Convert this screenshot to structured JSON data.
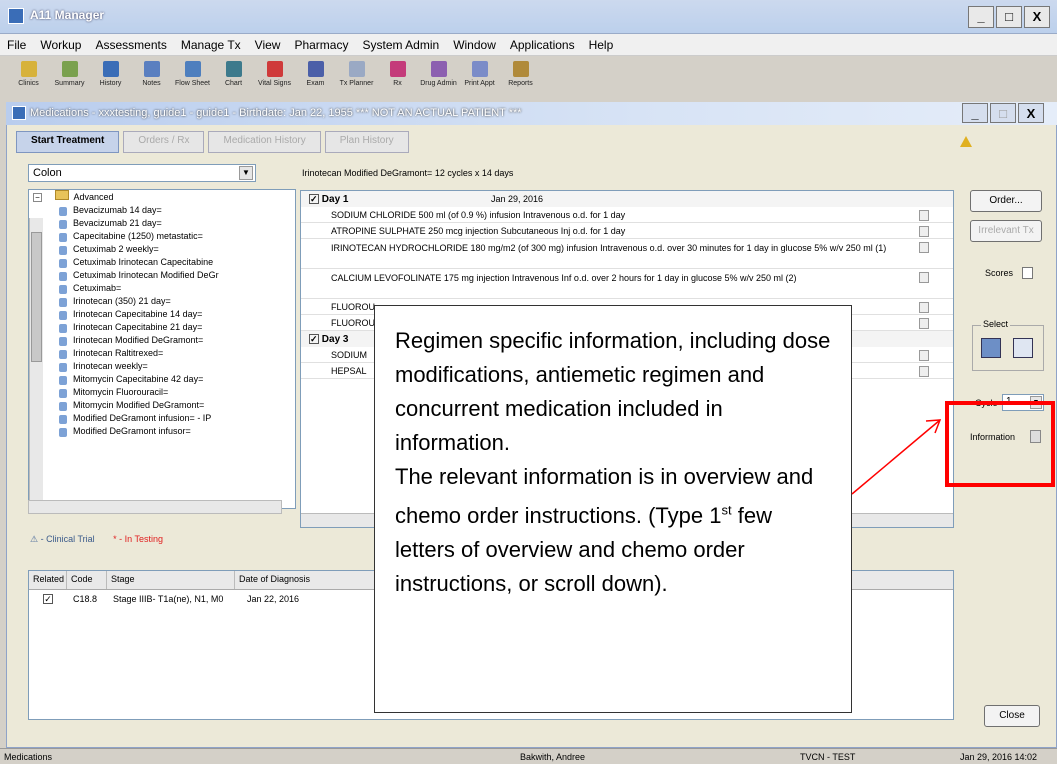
{
  "app": {
    "title": "A11 Manager"
  },
  "window_controls": {
    "minimize": "_",
    "maximize": "□",
    "close": "X"
  },
  "menu": [
    "File",
    "Workup",
    "Assessments",
    "Manage Tx",
    "View",
    "Pharmacy",
    "System Admin",
    "Window",
    "Applications",
    "Help"
  ],
  "toolbar": [
    {
      "label": "Clinics",
      "icon": "folder-icon",
      "color": "#d7b23b"
    },
    {
      "label": "Summary",
      "icon": "summary-icon",
      "color": "#7aa14e"
    },
    {
      "label": "History",
      "icon": "history-icon",
      "color": "#3a6db7"
    },
    {
      "label": "Notes",
      "icon": "notes-icon",
      "color": "#5a7fc0"
    },
    {
      "label": "Flow Sheet",
      "icon": "flowsheet-icon",
      "color": "#4e7fbe"
    },
    {
      "label": "Chart",
      "icon": "chart-icon",
      "color": "#3d7a8c"
    },
    {
      "label": "Vital Signs",
      "icon": "vitals-icon",
      "color": "#cf3a3a"
    },
    {
      "label": "Exam",
      "icon": "exam-icon",
      "color": "#4b5fa8"
    },
    {
      "label": "Tx Planner",
      "icon": "planner-icon",
      "color": "#9aa9c4"
    },
    {
      "label": "Rx",
      "icon": "rx-icon",
      "color": "#c43b7a"
    },
    {
      "label": "Drug Admin",
      "icon": "drug-admin-icon",
      "color": "#8c5fb0"
    },
    {
      "label": "Print Appt",
      "icon": "print-icon",
      "color": "#7b8cc8"
    },
    {
      "label": "Reports",
      "icon": "reports-icon",
      "color": "#b08a3a"
    }
  ],
  "child_window": {
    "title": "Medications - xxxtesting, guide1 - guide1 - Birthdate: Jan 22, 1955 *** NOT AN ACTUAL PATIENT ***"
  },
  "tabs": [
    "Start Treatment",
    "Orders / Rx",
    "Medication History",
    "Plan History"
  ],
  "disease_select": "Colon",
  "regimen_summary": "Irinotecan Modified DeGramont=  12 cycles x 14 days",
  "tree": {
    "root": "Advanced",
    "items": [
      "Bevacizumab 14 day=",
      "Bevacizumab 21 day=",
      "Capecitabine (1250) metastatic=",
      "Cetuximab 2 weekly=",
      "Cetuximab Irinotecan Capecitabine",
      "Cetuximab Irinotecan Modified DeGr",
      "Cetuximab=",
      "Irinotecan (350) 21 day=",
      "Irinotecan Capecitabine 14 day=",
      "Irinotecan Capecitabine 21 day=",
      "Irinotecan Modified DeGramont=",
      "Irinotecan Raltitrexed=",
      "Irinotecan weekly=",
      "Mitomycin Capecitabine 42 day=",
      "Mitomycin Fluorouracil=",
      "Mitomycin Modified DeGramont=",
      "Modified DeGramont infusion= - IP",
      "Modified DeGramont infusor="
    ]
  },
  "legend": {
    "clinical_trial": "- Clinical Trial",
    "in_testing": "* - In Testing"
  },
  "orders": {
    "day1": {
      "label": "Day 1",
      "date": "Jan 29, 2016"
    },
    "rows1": [
      "SODIUM CHLORIDE 500 ml (of 0.9 %) infusion Intravenous o.d. for 1 day",
      "ATROPINE SULPHATE 250 mcg injection Subcutaneous Inj o.d. for 1 day",
      "IRINOTECAN HYDROCHLORIDE 180 mg/m2 (of 300 mg) infusion Intravenous o.d. over 30 minutes for 1 day in glucose 5% w/v 250 ml (1)",
      "CALCIUM LEVOFOLINATE 175 mg injection Intravenous Inf o.d. over 2 hours for 1 day in glucose 5% w/v 250 ml (2)",
      "FLUOROU",
      "FLUOROU"
    ],
    "day3": {
      "label": "Day 3"
    },
    "rows3": [
      "SODIUM",
      "HEPSAL"
    ]
  },
  "right_panel": {
    "order": "Order...",
    "irrelevant": "Irrelevant Tx",
    "scores": "Scores",
    "select": "Select",
    "cycle_label": "Cycle",
    "cycle_value": "1",
    "information": "Information",
    "close": "Close"
  },
  "diagnosis": {
    "headers": [
      "Related",
      "Code",
      "Stage",
      "Date of Diagnosis"
    ],
    "row": {
      "code": "C18.8",
      "stage": "Stage IIIB- T1a(ne), N1, M0",
      "date": "Jan 22, 2016"
    }
  },
  "callout": {
    "p1": "Regimen specific information, including dose modifications, antiemetic regimen and concurrent medication included in information.",
    "p2a": "The relevant information is in overview and chemo order instructions. (Type 1",
    "p2sup": "st",
    "p2b": " few letters of overview and chemo order instructions, or scroll down)."
  },
  "status": {
    "left": "Medications",
    "user": "Bakwith, Andree",
    "server": "TVCN - TEST",
    "datetime": "Jan 29, 2016 14:02"
  },
  "colors": {
    "highlight": "#ff0000",
    "arrow": "#ff0000"
  }
}
